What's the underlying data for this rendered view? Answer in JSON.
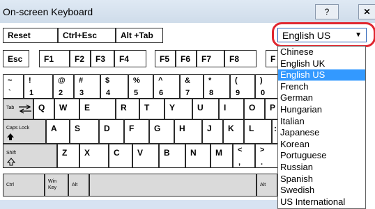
{
  "window": {
    "title": "On-screen Keyboard",
    "help_button": "?",
    "close_button": "✕"
  },
  "top_row": {
    "reset": "Reset",
    "ctrl_esc": "Ctrl+Esc",
    "alt_tab": "Alt +Tab"
  },
  "language": {
    "selected": "English US",
    "arrow": "▼",
    "options": [
      "Chinese",
      "English UK",
      "English US",
      "French",
      "German",
      "Hungarian",
      "Italian",
      "Japanese",
      "Korean",
      "Portuguese",
      "Russian",
      "Spanish",
      "Swedish",
      "US International"
    ],
    "active_index": 2
  },
  "keys": {
    "esc": "Esc",
    "f1": "F1",
    "f2": "F2",
    "f3": "F3",
    "f4": "F4",
    "f5": "F5",
    "f6": "F6",
    "f7": "F7",
    "f8": "F8",
    "f9": "F",
    "n_tilde_up": "~",
    "n_tilde_dn": "`",
    "n1_up": "!",
    "n1_dn": "1",
    "n2_up": "@",
    "n2_dn": "2",
    "n3_up": "#",
    "n3_dn": "3",
    "n4_up": "$",
    "n4_dn": "4",
    "n5_up": "%",
    "n5_dn": "5",
    "n6_up": "^",
    "n6_dn": "6",
    "n7_up": "&",
    "n7_dn": "7",
    "n8_up": "*",
    "n8_dn": "8",
    "n9_up": "(",
    "n9_dn": "9",
    "n0_up": ")",
    "n0_dn": "0",
    "tab": "Tab",
    "q": "Q",
    "w": "W",
    "e": "E",
    "r": "R",
    "t": "T",
    "y": "Y",
    "u": "U",
    "i": "I",
    "o": "O",
    "p": "P",
    "caps": "Caps Lock",
    "a": "A",
    "s": "S",
    "d": "D",
    "f": "F",
    "g": "G",
    "h": "H",
    "j": "J",
    "k": "K",
    "l": "L",
    "semi": ":",
    "shift": "Shift",
    "z": "Z",
    "x": "X",
    "c": "C",
    "v": "V",
    "b": "B",
    "n": "N",
    "m": "M",
    "lt_up": "<",
    "lt_dn": ",",
    "gt_up": ">",
    "gt_dn": ".",
    "ctrl": "Ctrl",
    "win": "Win Key",
    "alt": "Alt",
    "alt_r": "Alt"
  },
  "colors": {
    "highlight": "#e0262f",
    "selection": "#3399ff",
    "gray_key": "#dadada"
  }
}
